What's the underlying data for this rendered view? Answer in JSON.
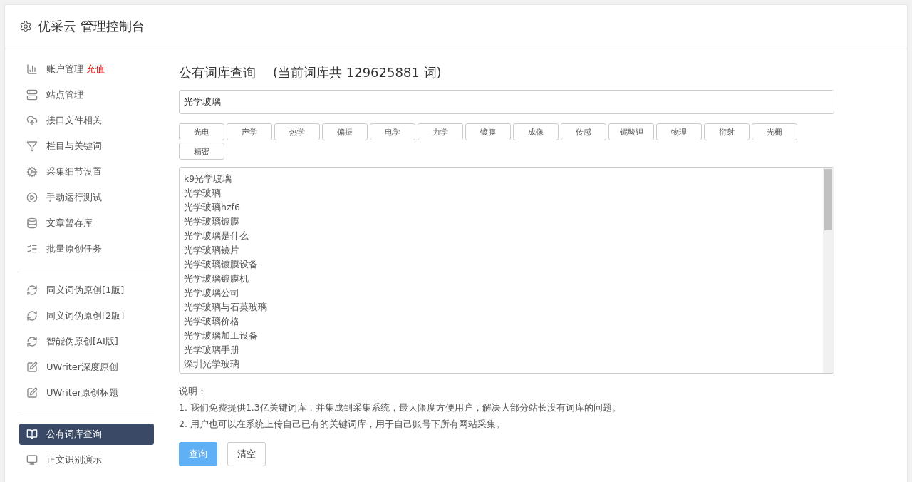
{
  "header": {
    "title": "优采云 管理控制台"
  },
  "sidebar": {
    "groups": [
      [
        {
          "label": "账户管理",
          "badge": "充值",
          "selected": false
        },
        {
          "label": "站点管理",
          "selected": false
        },
        {
          "label": "接口文件相关",
          "selected": false
        },
        {
          "label": "栏目与关键词",
          "selected": false
        },
        {
          "label": "采集细节设置",
          "selected": false
        },
        {
          "label": "手动运行测试",
          "selected": false
        },
        {
          "label": "文章暂存库",
          "selected": false
        },
        {
          "label": "批量原创任务",
          "selected": false
        }
      ],
      [
        {
          "label": "同义词伪原创[1版]",
          "selected": false
        },
        {
          "label": "同义词伪原创[2版]",
          "selected": false
        },
        {
          "label": "智能伪原创[AI版]",
          "selected": false
        },
        {
          "label": "UWriter深度原创",
          "selected": false
        },
        {
          "label": "UWriter原创标题",
          "selected": false
        }
      ],
      [
        {
          "label": "公有词库查询",
          "selected": true
        },
        {
          "label": "正文识别演示",
          "selected": false
        }
      ]
    ]
  },
  "main": {
    "title": "公有词库查询",
    "count_note": "(当前词库共 129625881 词)",
    "search": {
      "value": "光学玻璃"
    },
    "tags": [
      "光电",
      "声学",
      "热学",
      "偏振",
      "电学",
      "力学",
      "镀膜",
      "成像",
      "传感",
      "铌酸锂",
      "物理",
      "衍射",
      "光栅",
      "精密"
    ],
    "results": [
      "k9光学玻璃",
      "光学玻璃",
      "光学玻璃hzf6",
      "光学玻璃镀膜",
      "光学玻璃是什么",
      "光学玻璃镜片",
      "光学玻璃镀膜设备",
      "光学玻璃镀膜机",
      "光学玻璃公司",
      "光学玻璃与石英玻璃",
      "光学玻璃价格",
      "光学玻璃加工设备",
      "光学玻璃手册",
      "深圳光学玻璃"
    ],
    "notes_title": "说明：",
    "notes": [
      "1. 我们免费提供1.3亿关键词库，并集成到采集系统，最大限度方便用户，解决大部分站长没有词库的问题。",
      "2. 用户也可以在系统上传自己已有的关键词库，用于自己账号下所有网站采集。"
    ],
    "buttons": [
      {
        "label": "查询",
        "kind": "primary"
      },
      {
        "label": "清空",
        "kind": "default"
      }
    ]
  }
}
